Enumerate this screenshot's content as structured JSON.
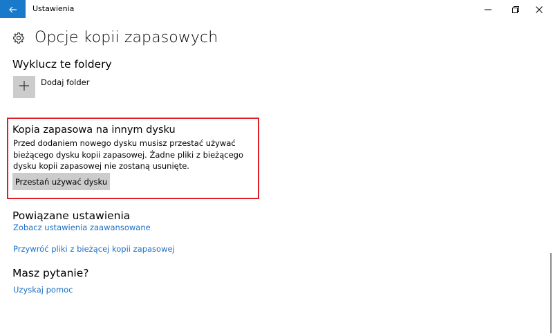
{
  "window": {
    "title": "Ustawienia"
  },
  "header": {
    "title": "Opcje kopii zapasowych"
  },
  "exclude": {
    "heading": "Wyklucz te foldery",
    "add_label": "Dodaj folder"
  },
  "other_drive": {
    "heading": "Kopia zapasowa na innym dysku",
    "description": "Przed dodaniem nowego dysku musisz przestać używać bieżącego dysku kopii zapasowej. Żadne pliki z bieżącego dysku kopii zapasowej nie zostaną usunięte.",
    "button_label": "Przestań używać dysku",
    "highlight_color": "#e01e25"
  },
  "related": {
    "heading": "Powiązane ustawienia",
    "links": [
      "Zobacz ustawienia zaawansowane",
      "Przywróć pliki z bieżącej kopii zapasowej"
    ]
  },
  "help": {
    "heading": "Masz pytanie?",
    "link": "Uzyskaj pomoc"
  },
  "colors": {
    "accent": "#1979ca",
    "link": "#1a6fc4",
    "button_bg": "#cccccc"
  },
  "icons": {
    "back": "back-arrow-icon",
    "minimize": "minimize-icon",
    "maximize": "restore-icon",
    "close": "close-icon",
    "settings": "gear-icon",
    "add": "plus-icon"
  }
}
